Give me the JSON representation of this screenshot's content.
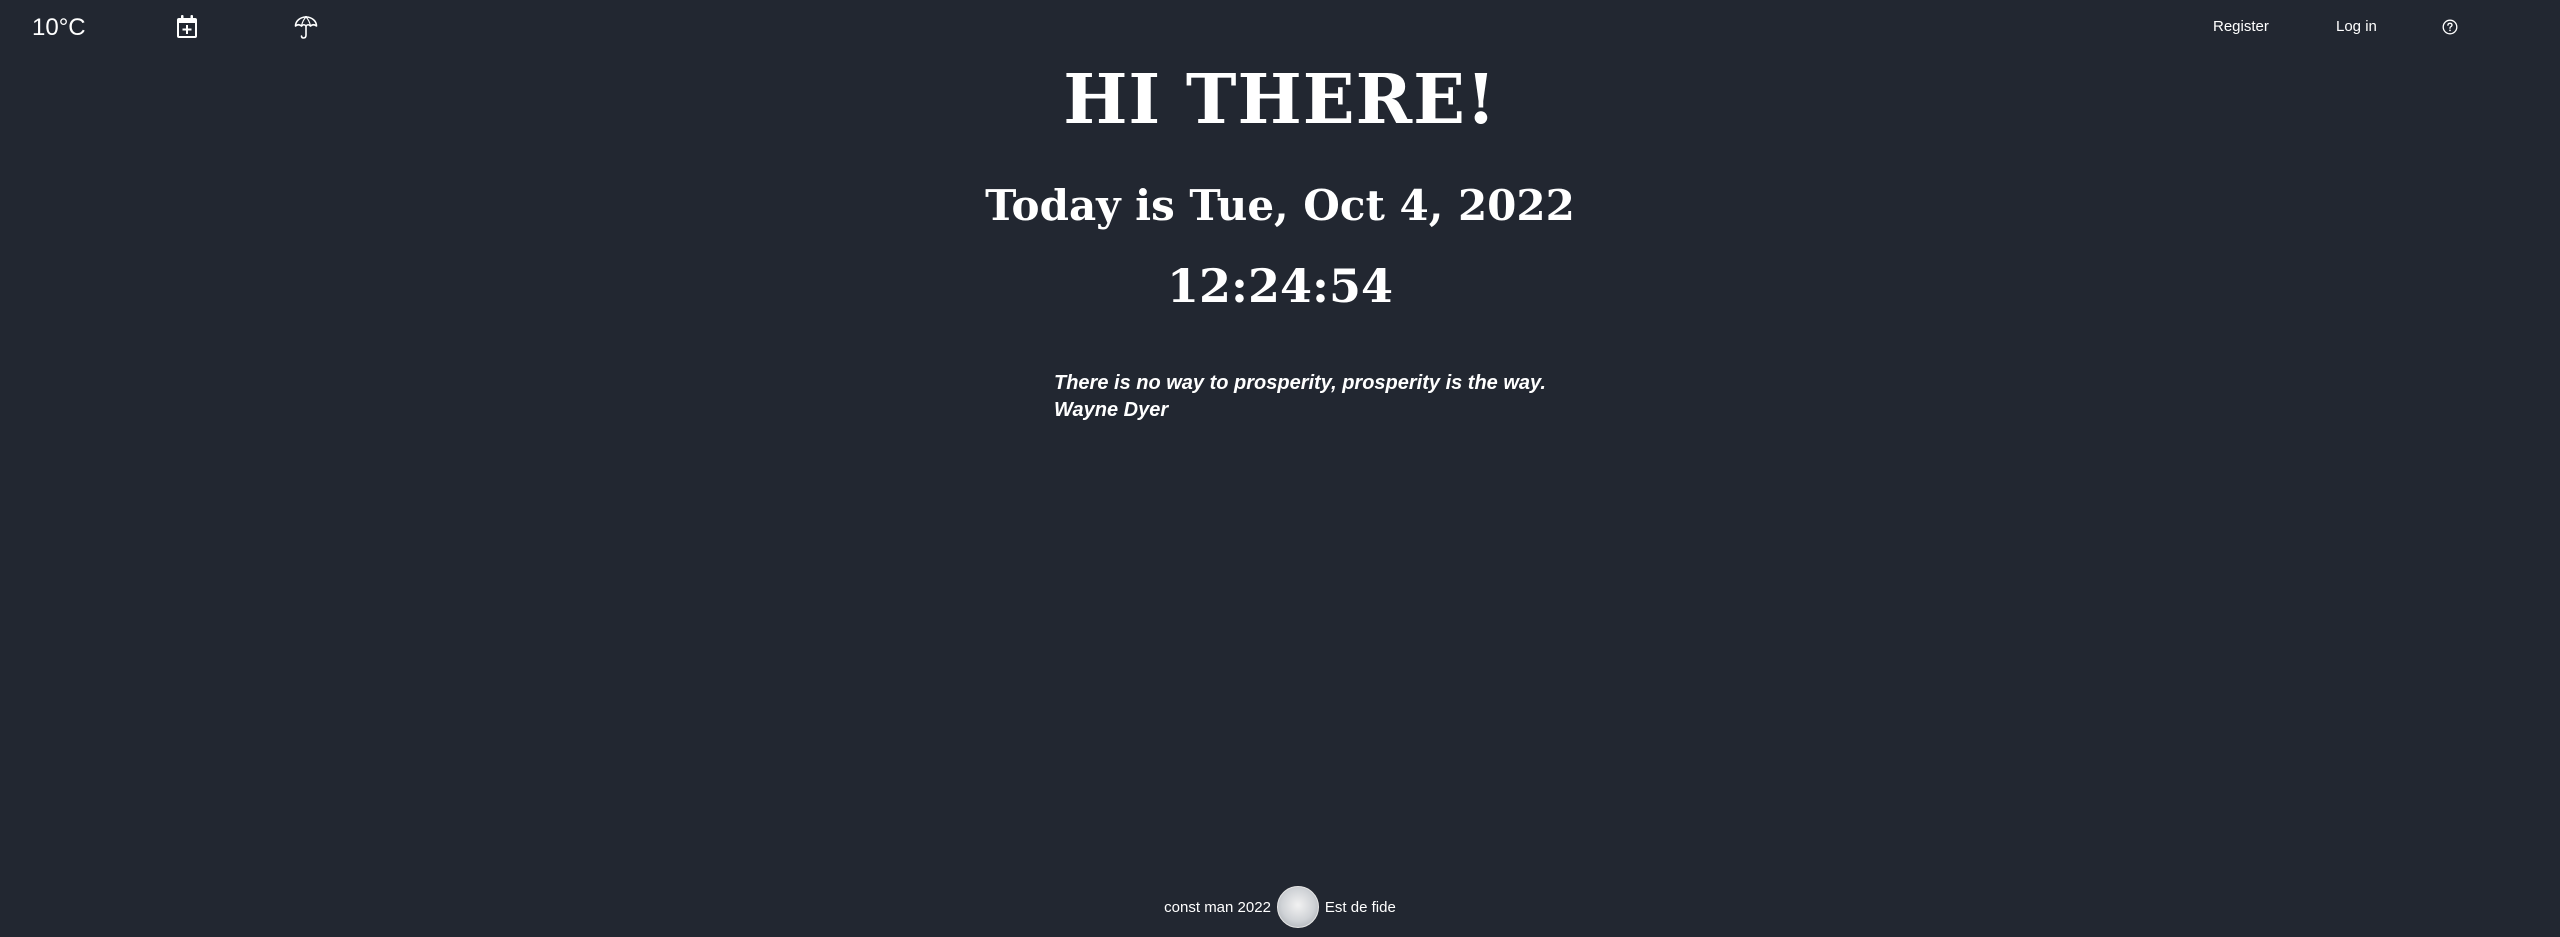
{
  "weather": {
    "temperature": "10°C",
    "calendar_icon": "calendar-plus-icon",
    "umbrella_icon": "umbrella-icon"
  },
  "nav": {
    "register_label": "Register",
    "login_label": "Log in",
    "help_icon": "question-circle-icon"
  },
  "main": {
    "greeting": "HI THERE!",
    "date_text": "Today is Tue, Oct 4, 2022",
    "time_text": "12:24:54"
  },
  "quote": {
    "text": "There is no way to prosperity, prosperity is the way.",
    "author": "Wayne Dyer"
  },
  "footer": {
    "left_text": "const man 2022",
    "right_text": "Est de fide"
  },
  "colors": {
    "background": "#222731",
    "text": "#ffffff"
  }
}
